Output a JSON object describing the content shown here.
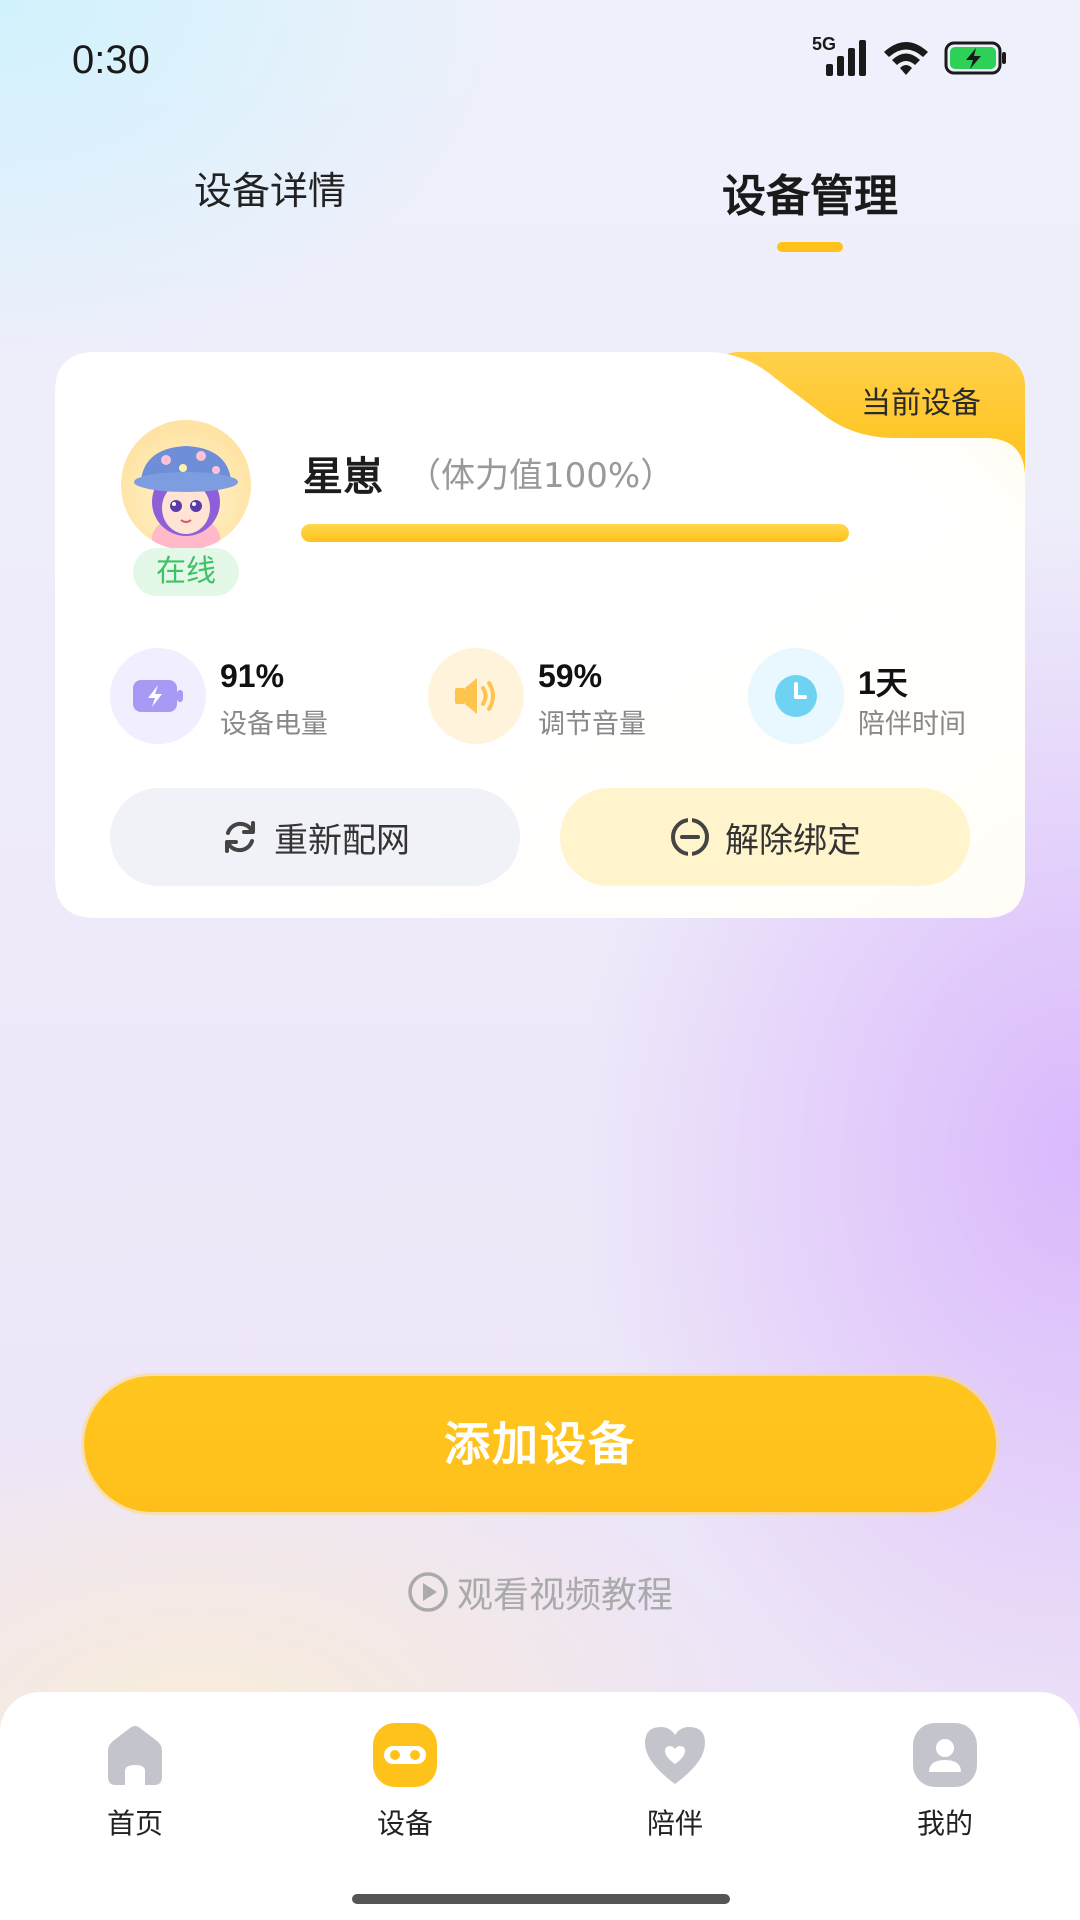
{
  "status_bar": {
    "time": "0:30",
    "network": "5G"
  },
  "tabs": [
    {
      "label": "设备详情",
      "active": false
    },
    {
      "label": "设备管理",
      "active": true
    }
  ],
  "device_card": {
    "current_tag": "当前设备",
    "name": "星崽",
    "stamina_text": "（体力值100%）",
    "stamina_fraction": 1.0,
    "status": "在线",
    "stats": [
      {
        "value": "91%",
        "label": "设备电量",
        "icon": "battery-icon"
      },
      {
        "value": "59%",
        "label": "调节音量",
        "icon": "speaker-icon"
      },
      {
        "value": "1天",
        "label": "陪伴时间",
        "icon": "clock-icon"
      }
    ],
    "actions": {
      "repair_network": "重新配网",
      "unbind": "解除绑定"
    }
  },
  "add_device_label": "添加设备",
  "tutorial_label": "观看视频教程",
  "bottom_nav": [
    {
      "label": "首页",
      "icon": "home-icon",
      "active": false
    },
    {
      "label": "设备",
      "icon": "device-icon",
      "active": true
    },
    {
      "label": "陪伴",
      "icon": "heart-icon",
      "active": false
    },
    {
      "label": "我的",
      "icon": "profile-icon",
      "active": false
    }
  ],
  "colors": {
    "accent": "#FFC21A",
    "online_green": "#41C06A",
    "inactive_icon": "#C4C4CC"
  }
}
